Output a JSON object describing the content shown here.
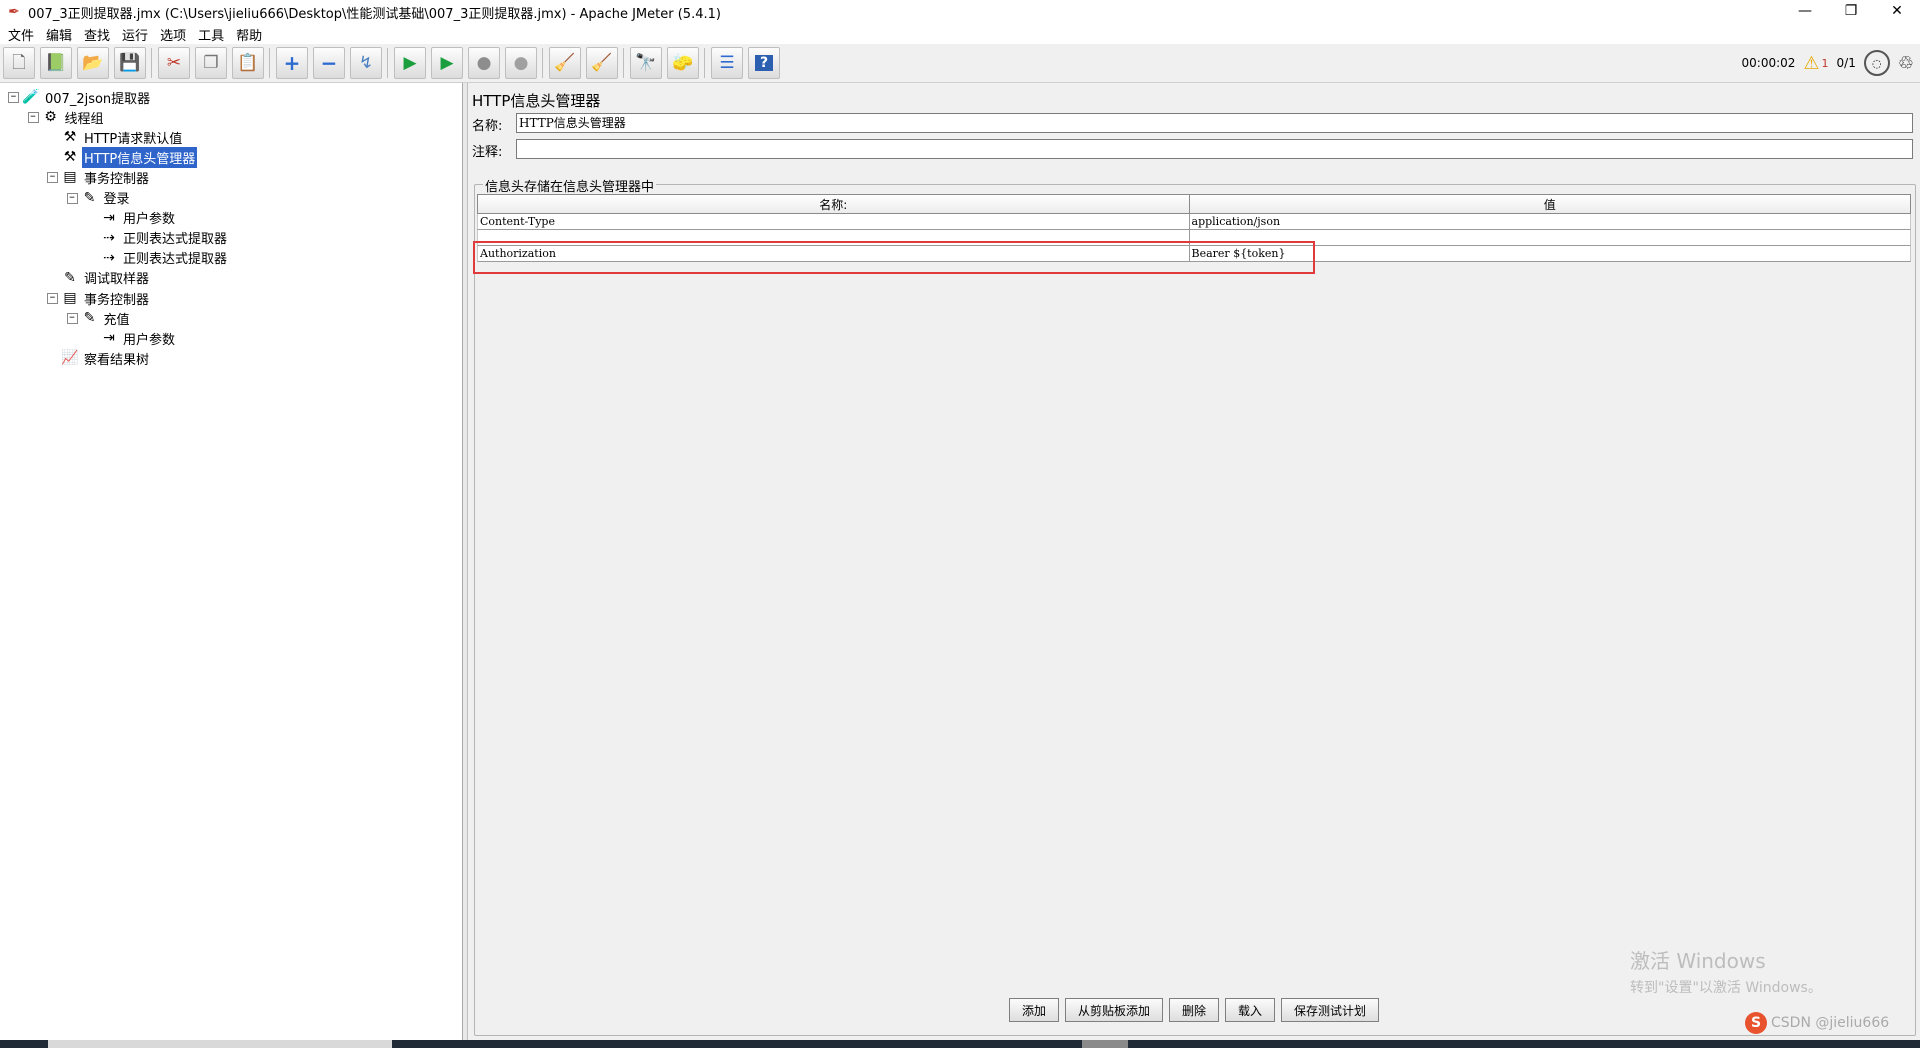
{
  "window": {
    "title": "007_3正则提取器.jmx (C:\\Users\\jieliu666\\Desktop\\性能测试基础\\007_3正则提取器.jmx) - Apache JMeter (5.4.1)",
    "controls": {
      "minimize": "—",
      "restore": "❐",
      "close": "✕"
    }
  },
  "menu": [
    "文件",
    "编辑",
    "查找",
    "运行",
    "选项",
    "工具",
    "帮助"
  ],
  "toolbar": {
    "buttons": [
      {
        "name": "new-icon",
        "glyph": "🗋"
      },
      {
        "name": "templates-icon",
        "glyph": "📗"
      },
      {
        "name": "open-icon",
        "glyph": "📂"
      },
      {
        "name": "save-icon",
        "glyph": "💾"
      },
      {
        "name": "cut-icon",
        "glyph": "✂"
      },
      {
        "name": "copy-icon",
        "glyph": "❐"
      },
      {
        "name": "paste-icon",
        "glyph": "📋"
      },
      {
        "name": "expand-icon",
        "glyph": "+"
      },
      {
        "name": "collapse-icon",
        "glyph": "−"
      },
      {
        "name": "toggle-icon",
        "glyph": "↯"
      },
      {
        "name": "start-icon",
        "glyph": "▶"
      },
      {
        "name": "start-no-pause-icon",
        "glyph": "▶"
      },
      {
        "name": "stop-icon",
        "glyph": "●"
      },
      {
        "name": "shutdown-icon",
        "glyph": "●"
      },
      {
        "name": "clear-icon",
        "glyph": "🧹"
      },
      {
        "name": "clear-all-icon",
        "glyph": "🧹"
      },
      {
        "name": "search-icon",
        "glyph": "🔭"
      },
      {
        "name": "reset-search-icon",
        "glyph": "🧽"
      },
      {
        "name": "function-helper-icon",
        "glyph": "☰"
      },
      {
        "name": "help-icon",
        "glyph": "?"
      }
    ],
    "timer": "00:00:02",
    "warning_count": "1",
    "threads": "0/1"
  },
  "tree": [
    {
      "label": "007_2json提取器",
      "icon": "🧪",
      "depth": 0,
      "toggle": "−"
    },
    {
      "label": "线程组",
      "icon": "⚙",
      "depth": 1,
      "toggle": "−"
    },
    {
      "label": "HTTP请求默认值",
      "icon": "⚒",
      "depth": 2,
      "toggle": ""
    },
    {
      "label": "HTTP信息头管理器",
      "icon": "⚒",
      "depth": 2,
      "toggle": "",
      "selected": true
    },
    {
      "label": "事务控制器",
      "icon": "▤",
      "depth": 2,
      "toggle": "−"
    },
    {
      "label": "登录",
      "icon": "✎",
      "depth": 3,
      "toggle": "−"
    },
    {
      "label": "用户参数",
      "icon": "⇥",
      "depth": 4,
      "toggle": ""
    },
    {
      "label": "正则表达式提取器",
      "icon": "⇢",
      "depth": 4,
      "toggle": ""
    },
    {
      "label": "正则表达式提取器",
      "icon": "⇢",
      "depth": 4,
      "toggle": ""
    },
    {
      "label": "调试取样器",
      "icon": "✎",
      "depth": 2,
      "toggle": ""
    },
    {
      "label": "事务控制器",
      "icon": "▤",
      "depth": 2,
      "toggle": "−"
    },
    {
      "label": "充值",
      "icon": "✎",
      "depth": 3,
      "toggle": "−"
    },
    {
      "label": "用户参数",
      "icon": "⇥",
      "depth": 4,
      "toggle": ""
    },
    {
      "label": "察看结果树",
      "icon": "📈",
      "depth": 2,
      "toggle": ""
    }
  ],
  "panel": {
    "title": "HTTP信息头管理器",
    "name_label": "名称:",
    "name_value": "HTTP信息头管理器",
    "comment_label": "注释:",
    "comment_value": "",
    "group_title": "信息头存储在信息头管理器中",
    "table": {
      "headers": [
        "名称:",
        "值"
      ],
      "rows": [
        [
          "Content-Type",
          "application/json"
        ],
        [
          "",
          ""
        ],
        [
          "Authorization",
          "Bearer ${token}"
        ]
      ]
    },
    "buttons": [
      "添加",
      "从剪贴板添加",
      "删除",
      "载入",
      "保存测试计划"
    ]
  },
  "watermark": {
    "line1": "激活 Windows",
    "line2": "转到\"设置\"以激活 Windows。"
  },
  "csdn": {
    "logo": "S",
    "text": "CSDN @jieliu666"
  }
}
